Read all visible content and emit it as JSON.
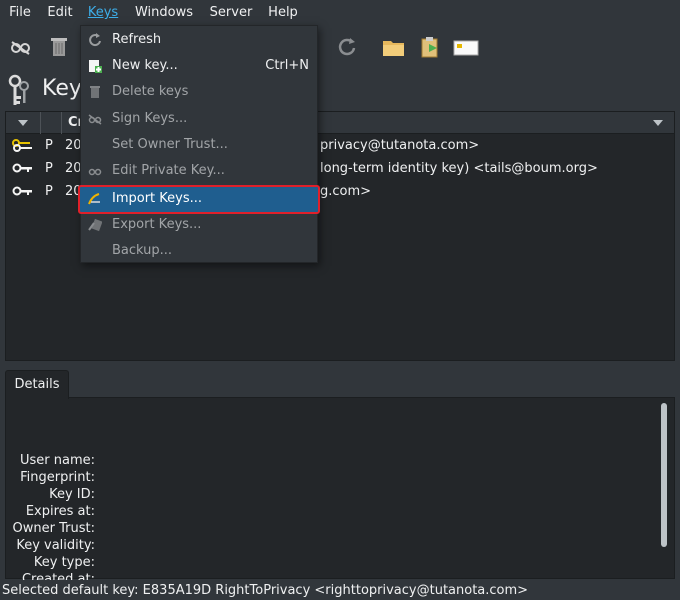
{
  "menubar": {
    "items": [
      "File",
      "Edit",
      "Keys",
      "Windows",
      "Server",
      "Help"
    ],
    "active": "Keys"
  },
  "toolbar": {
    "buttons": [
      "sign-icon",
      "delete-icon",
      "refresh-icon",
      "folder-icon",
      "import-icon",
      "card-icon"
    ]
  },
  "header": {
    "title": "Key"
  },
  "keylist": {
    "column_label": "Cr",
    "rows": [
      {
        "flag": "P",
        "date": "20",
        "uid": "privacy@tutanota.com>",
        "icon": "keypair-icon"
      },
      {
        "flag": "P",
        "date": "20",
        "uid": "long-term identity key) <tails@boum.org>",
        "icon": "key-icon"
      },
      {
        "flag": "P",
        "date": "20",
        "uid": "g.com>",
        "icon": "key-icon"
      }
    ]
  },
  "keys_menu": {
    "items": [
      {
        "label": "Refresh",
        "shortcut": "",
        "icon": "refresh-icon",
        "disabled": false
      },
      {
        "label": "New key...",
        "shortcut": "Ctrl+N",
        "icon": "new-key-icon",
        "disabled": false
      },
      {
        "label": "Delete keys",
        "shortcut": "",
        "icon": "trash-icon",
        "disabled": true
      },
      {
        "label": "Sign Keys...",
        "shortcut": "",
        "icon": "sign-icon",
        "disabled": true
      },
      {
        "label": "Set Owner Trust...",
        "shortcut": "",
        "icon": "",
        "disabled": true
      },
      {
        "label": "Edit Private Key...",
        "shortcut": "",
        "icon": "edit-key-icon",
        "disabled": true
      },
      {
        "label": "Import Keys...",
        "shortcut": "",
        "icon": "import-key-icon",
        "disabled": false,
        "highlighted": true
      },
      {
        "label": "Export Keys...",
        "shortcut": "",
        "icon": "export-key-icon",
        "disabled": true
      },
      {
        "label": "Backup...",
        "shortcut": "",
        "icon": "",
        "disabled": true
      }
    ]
  },
  "details": {
    "tab_label": "Details",
    "labels": [
      "User name:",
      "Fingerprint:",
      "Key ID:",
      "Expires at:",
      "Owner Trust:",
      "Key validity:",
      "Key type:",
      "Created at:"
    ]
  },
  "status": {
    "text": "Selected default key: E835A19D RightToPrivacy <righttoprivacy@tutanota.com>"
  },
  "colors": {
    "background": "#31363b",
    "view": "#232629",
    "highlight": "#1f5e8f",
    "highlight_border": "#e0202a",
    "accent": "#3daee9"
  }
}
